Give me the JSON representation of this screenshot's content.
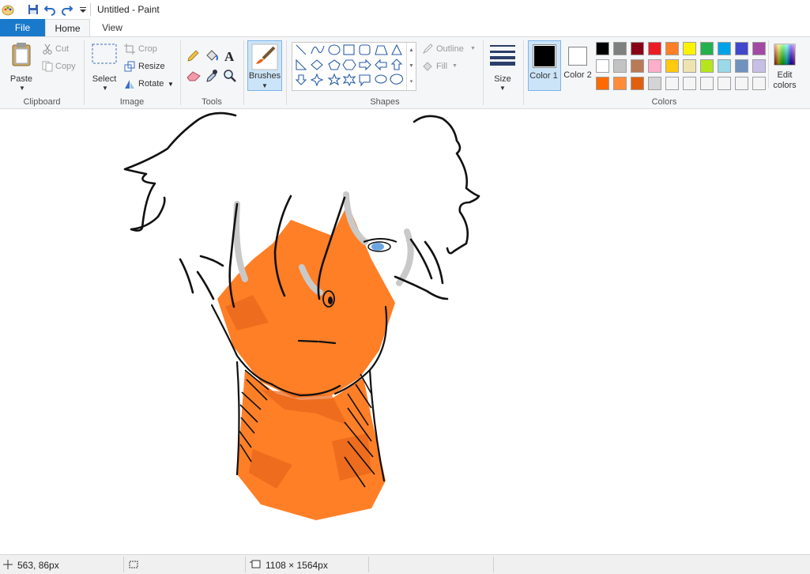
{
  "window": {
    "title": "Untitled - Paint"
  },
  "tabs": {
    "file": "File",
    "home": "Home",
    "view": "View"
  },
  "clipboard": {
    "paste": "Paste",
    "cut": "Cut",
    "copy": "Copy",
    "label": "Clipboard"
  },
  "image": {
    "select": "Select",
    "crop": "Crop",
    "resize": "Resize",
    "rotate": "Rotate",
    "label": "Image"
  },
  "tools": {
    "label": "Tools"
  },
  "brushes": {
    "label": "Brushes"
  },
  "shapes": {
    "label": "Shapes",
    "outline": "Outline",
    "fill": "Fill"
  },
  "size": {
    "label": "Size"
  },
  "colors": {
    "color1": "Color 1",
    "color2": "Color 2",
    "label": "Colors",
    "edit": "Edit colors",
    "color1_value": "#000000",
    "color2_value": "#ffffff",
    "palette_row1": [
      "#000000",
      "#7f7f7f",
      "#880015",
      "#ed1c24",
      "#ff7f27",
      "#fff200",
      "#22b14c",
      "#00a2e8",
      "#3f48cc",
      "#a349a4"
    ],
    "palette_row2": [
      "#ffffff",
      "#c3c3c3",
      "#b97a57",
      "#ffaec9",
      "#ffc90e",
      "#efe4b0",
      "#b5e61d",
      "#99d9ea",
      "#7092be",
      "#c8bfe7"
    ],
    "palette_row3": [
      "#ff6a00",
      "#ff8c3a",
      "#e06010",
      "#d4d4d4",
      "#f5f5f5",
      "#f5f5f5",
      "#f5f5f5",
      "#f5f5f5",
      "#f5f5f5",
      "#f5f5f5"
    ]
  },
  "status": {
    "cursor": "563, 86px",
    "selection": "",
    "canvas_size": "1108 × 1564px"
  },
  "drawing": {
    "skin_color": "#ff7f27",
    "shade_color": "#e8651a",
    "eye_color": "#6aa6e0"
  }
}
